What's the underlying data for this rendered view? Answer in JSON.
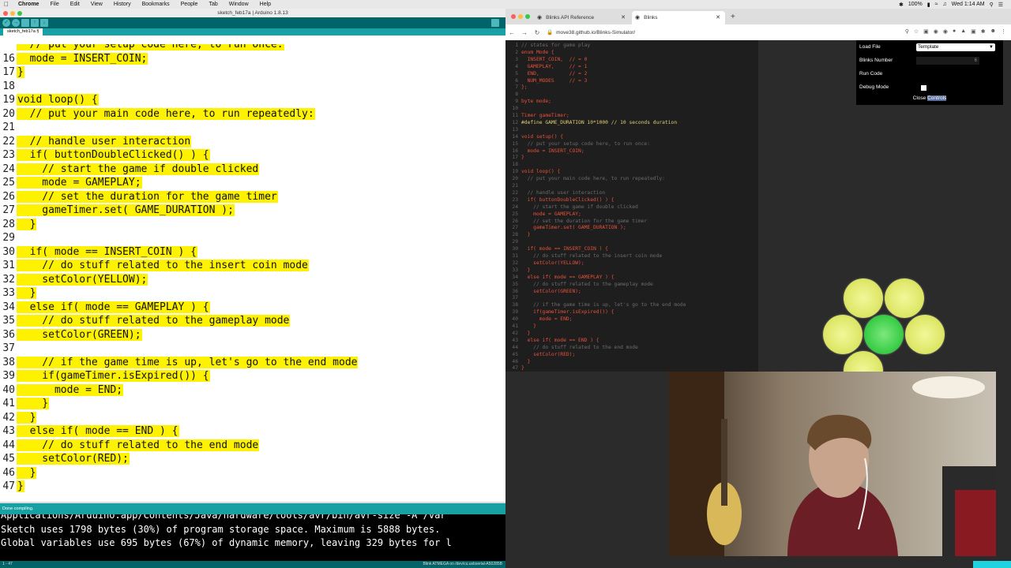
{
  "menubar": {
    "app": "Chrome",
    "items": [
      "File",
      "Edit",
      "View",
      "History",
      "Bookmarks",
      "People",
      "Tab",
      "Window",
      "Help"
    ],
    "battery": "100%",
    "clock": "Wed 1:14 AM"
  },
  "arduino": {
    "window_title": "sketch_feb17a | Arduino 1.8.13",
    "tab_name": "sketch_feb17a §",
    "code_lines": [
      {
        "num": "",
        "text": "  // put your setup code here, to run once:"
      },
      {
        "num": "16",
        "text": "  mode = INSERT_COIN;"
      },
      {
        "num": "17",
        "text": "}"
      },
      {
        "num": "18",
        "text": ""
      },
      {
        "num": "19",
        "text": "void loop() {"
      },
      {
        "num": "20",
        "text": "  // put your main code here, to run repeatedly:"
      },
      {
        "num": "21",
        "text": ""
      },
      {
        "num": "22",
        "text": "  // handle user interaction"
      },
      {
        "num": "23",
        "text": "  if( buttonDoubleClicked() ) {"
      },
      {
        "num": "24",
        "text": "    // start the game if double clicked"
      },
      {
        "num": "25",
        "text": "    mode = GAMEPLAY;"
      },
      {
        "num": "26",
        "text": "    // set the duration for the game timer"
      },
      {
        "num": "27",
        "text": "    gameTimer.set( GAME_DURATION );"
      },
      {
        "num": "28",
        "text": "  }"
      },
      {
        "num": "29",
        "text": ""
      },
      {
        "num": "30",
        "text": "  if( mode == INSERT_COIN ) {"
      },
      {
        "num": "31",
        "text": "    // do stuff related to the insert coin mode"
      },
      {
        "num": "32",
        "text": "    setColor(YELLOW);"
      },
      {
        "num": "33",
        "text": "  }"
      },
      {
        "num": "34",
        "text": "  else if( mode == GAMEPLAY ) {"
      },
      {
        "num": "35",
        "text": "    // do stuff related to the gameplay mode"
      },
      {
        "num": "36",
        "text": "    setColor(GREEN);"
      },
      {
        "num": "37",
        "text": ""
      },
      {
        "num": "38",
        "text": "    // if the game time is up, let's go to the end mode"
      },
      {
        "num": "39",
        "text": "    if(gameTimer.isExpired()) {"
      },
      {
        "num": "40",
        "text": "      mode = END;"
      },
      {
        "num": "41",
        "text": "    }"
      },
      {
        "num": "42",
        "text": "  }"
      },
      {
        "num": "43",
        "text": "  else if( mode == END ) {"
      },
      {
        "num": "44",
        "text": "    // do stuff related to the end mode"
      },
      {
        "num": "45",
        "text": "    setColor(RED);"
      },
      {
        "num": "46",
        "text": "  }"
      },
      {
        "num": "47",
        "text": "}"
      }
    ],
    "status": "Done compiling.",
    "console_lines": [
      "Applications/Arduino.app/Contents/Java/hardware/tools/avr/bin/avr-size -A /var",
      "Sketch uses 1798 bytes (30%) of program storage space. Maximum is 5888 bytes.",
      "Global variables use 695 bytes (67%) of dynamic memory, leaving 329 bytes for l"
    ],
    "footer_left": "1 - 47",
    "footer_right": "Blink ATMEGA on /dev/cu.usbserial-A50285B"
  },
  "chrome": {
    "tabs": [
      {
        "title": "Blinks API Reference",
        "active": false
      },
      {
        "title": "Blinks",
        "active": true
      }
    ],
    "url": "move38.github.io/Blinks-Simulator/"
  },
  "sim": {
    "code_lines": [
      {
        "num": "1",
        "text": "// states for game play",
        "cls": "cm"
      },
      {
        "num": "2",
        "text": "enum Mode {",
        "cls": ""
      },
      {
        "num": "3",
        "text": "  INSERT_COIN,  // = 0",
        "cls": ""
      },
      {
        "num": "4",
        "text": "  GAMEPLAY,     // = 1",
        "cls": ""
      },
      {
        "num": "5",
        "text": "  END,          // = 2",
        "cls": ""
      },
      {
        "num": "6",
        "text": "  NUM_MODES     // = 3",
        "cls": ""
      },
      {
        "num": "7",
        "text": "};",
        "cls": ""
      },
      {
        "num": "8",
        "text": "",
        "cls": ""
      },
      {
        "num": "9",
        "text": "byte mode;",
        "cls": ""
      },
      {
        "num": "10",
        "text": "",
        "cls": ""
      },
      {
        "num": "11",
        "text": "Timer gameTimer;",
        "cls": ""
      },
      {
        "num": "12",
        "text": "#define GAME_DURATION 10*1000 // 10 seconds duration",
        "cls": "kw"
      },
      {
        "num": "13",
        "text": "",
        "cls": ""
      },
      {
        "num": "14",
        "text": "void setup() {",
        "cls": ""
      },
      {
        "num": "15",
        "text": "  // put your setup code here, to run once:",
        "cls": "cm"
      },
      {
        "num": "16",
        "text": "  mode = INSERT_COIN;",
        "cls": ""
      },
      {
        "num": "17",
        "text": "}",
        "cls": ""
      },
      {
        "num": "18",
        "text": "",
        "cls": ""
      },
      {
        "num": "19",
        "text": "void loop() {",
        "cls": ""
      },
      {
        "num": "20",
        "text": "  // put your main code here, to run repeatedly:",
        "cls": "cm"
      },
      {
        "num": "21",
        "text": "",
        "cls": ""
      },
      {
        "num": "22",
        "text": "  // handle user interaction",
        "cls": "cm"
      },
      {
        "num": "23",
        "text": "  if( buttonDoubleClicked() ) {",
        "cls": ""
      },
      {
        "num": "24",
        "text": "    // start the game if double clicked",
        "cls": "cm"
      },
      {
        "num": "25",
        "text": "    mode = GAMEPLAY;",
        "cls": ""
      },
      {
        "num": "26",
        "text": "    // set the duration for the game timer",
        "cls": "cm"
      },
      {
        "num": "27",
        "text": "    gameTimer.set( GAME_DURATION );",
        "cls": ""
      },
      {
        "num": "28",
        "text": "  }",
        "cls": ""
      },
      {
        "num": "29",
        "text": "",
        "cls": ""
      },
      {
        "num": "30",
        "text": "  if( mode == INSERT_COIN ) {",
        "cls": ""
      },
      {
        "num": "31",
        "text": "    // do stuff related to the insert coin mode",
        "cls": "cm"
      },
      {
        "num": "32",
        "text": "    setColor(YELLOW);",
        "cls": ""
      },
      {
        "num": "33",
        "text": "  }",
        "cls": ""
      },
      {
        "num": "34",
        "text": "  else if( mode == GAMEPLAY ) {",
        "cls": ""
      },
      {
        "num": "35",
        "text": "    // do stuff related to the gameplay mode",
        "cls": "cm"
      },
      {
        "num": "36",
        "text": "    setColor(GREEN);",
        "cls": ""
      },
      {
        "num": "37",
        "text": "",
        "cls": ""
      },
      {
        "num": "38",
        "text": "    // if the game time is up, let's go to the end mode",
        "cls": "cm"
      },
      {
        "num": "39",
        "text": "    if(gameTimer.isExpired()) {",
        "cls": ""
      },
      {
        "num": "40",
        "text": "      mode = END;",
        "cls": ""
      },
      {
        "num": "41",
        "text": "    }",
        "cls": ""
      },
      {
        "num": "42",
        "text": "  }",
        "cls": ""
      },
      {
        "num": "43",
        "text": "  else if( mode == END ) {",
        "cls": ""
      },
      {
        "num": "44",
        "text": "    // do stuff related to the end mode",
        "cls": "cm"
      },
      {
        "num": "45",
        "text": "    setColor(RED);",
        "cls": ""
      },
      {
        "num": "46",
        "text": "  }",
        "cls": ""
      },
      {
        "num": "47",
        "text": "}",
        "cls": ""
      }
    ],
    "controls": {
      "load_file_label": "Load File",
      "load_file_value": "Template",
      "blinks_number_label": "Blinks Number",
      "blinks_number_value": "6",
      "run_code_label": "Run Code",
      "debug_mode_label": "Debug Mode",
      "close_label": "Close",
      "close_highlight": "Controls"
    },
    "blinks": [
      {
        "color": "yellow"
      },
      {
        "color": "yellow"
      },
      {
        "color": "yellow"
      },
      {
        "color": "green"
      },
      {
        "color": "yellow"
      },
      {
        "color": "yellow"
      }
    ]
  }
}
